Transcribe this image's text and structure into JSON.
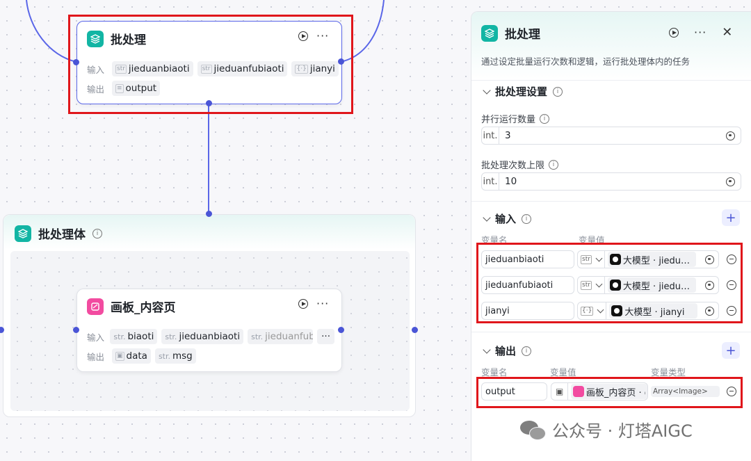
{
  "batch_node": {
    "title": "批处理",
    "input_label": "输入",
    "output_label": "输出",
    "inputs": [
      {
        "type": "str",
        "name": "jieduanbiaoti"
      },
      {
        "type": "str",
        "name": "jieduanfubiaoti"
      },
      {
        "type": "{·}",
        "name": "jianyi"
      }
    ],
    "outputs": [
      {
        "type": "list",
        "name": "output"
      }
    ]
  },
  "batch_body": {
    "title": "批处理体"
  },
  "canvas_node": {
    "title": "画板_内容页",
    "input_label": "输入",
    "output_label": "输出",
    "inputs": [
      {
        "type": "str.",
        "name": "biaoti"
      },
      {
        "type": "str.",
        "name": "jieduanbiaoti"
      },
      {
        "type": "str.",
        "name": "jieduanfubi"
      }
    ],
    "more_label": "···",
    "outputs": [
      {
        "type": "image",
        "name": "data"
      },
      {
        "type": "str.",
        "name": "msg"
      }
    ]
  },
  "panel": {
    "title": "批处理",
    "description": "通过设定批量运行次数和逻辑，运行批处理体内的任务",
    "settings": {
      "title": "批处理设置",
      "parallel_label": "并行运行数量",
      "parallel_type": "int.",
      "parallel_value": "3",
      "limit_label": "批处理次数上限",
      "limit_type": "int.",
      "limit_value": "10"
    },
    "input_section": {
      "title": "输入",
      "col_name": "变量名",
      "col_value": "变量值",
      "rows": [
        {
          "name": "jieduanbiaoti",
          "type": "str",
          "ref": "大模型 · jieduanbiaoti"
        },
        {
          "name": "jieduanfubiaoti",
          "type": "str",
          "ref": "大模型 · jieduanfubiaoti"
        },
        {
          "name": "jianyi",
          "type": "{·}",
          "ref": "大模型 · jianyi"
        }
      ]
    },
    "output_section": {
      "title": "输出",
      "col_name": "变量名",
      "col_value": "变量值",
      "col_type": "变量类型",
      "rows": [
        {
          "name": "output",
          "ref": "画板_内容页 · data",
          "var_type": "Array<Image>"
        }
      ]
    }
  },
  "watermark": {
    "text": "公众号 · 灯塔AIGC"
  },
  "colors": {
    "accent": "#4a55d6",
    "highlight_box": "#e0161b",
    "teal_icon": "#12b5a4",
    "pink_icon": "#f24ba0"
  }
}
